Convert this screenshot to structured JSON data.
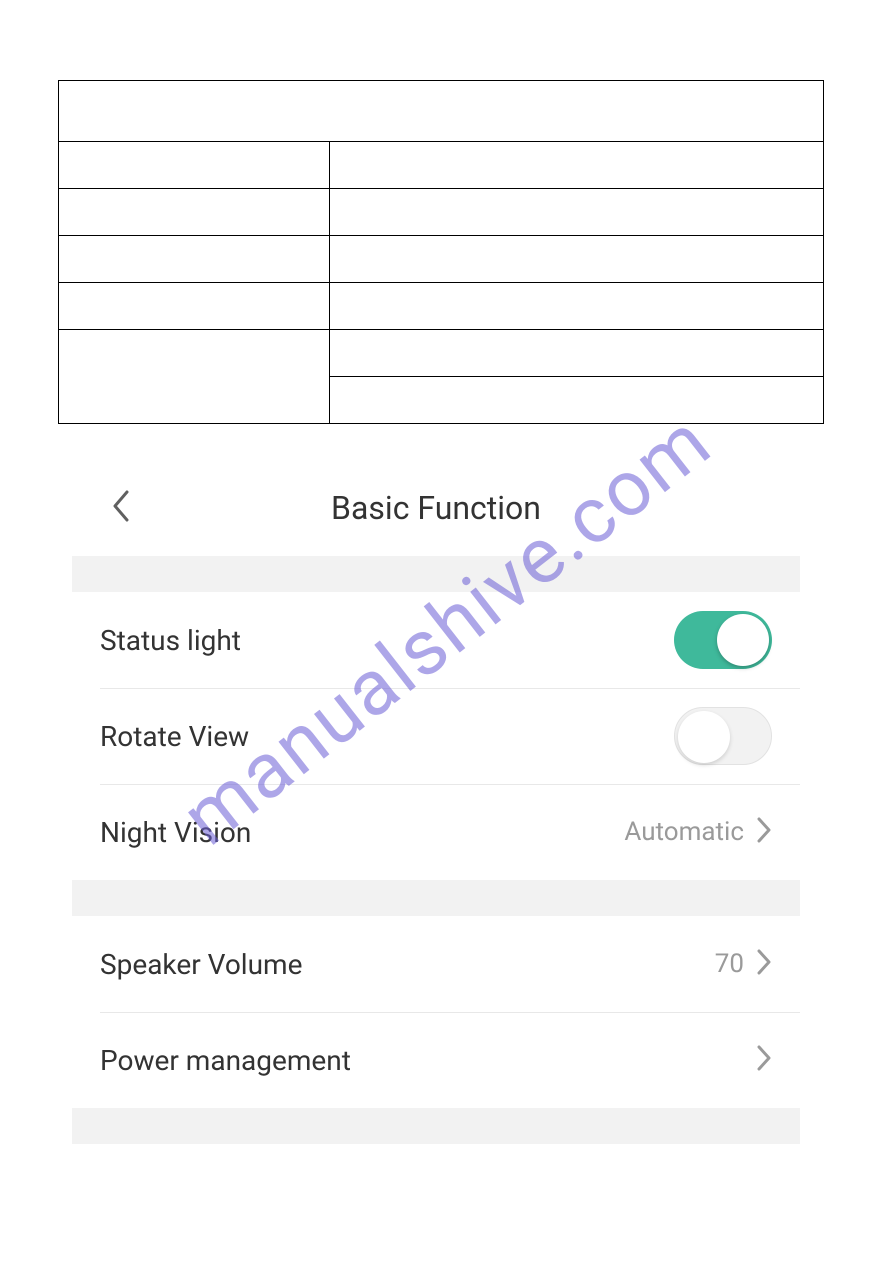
{
  "header": {
    "title": "Basic Function"
  },
  "rows": {
    "status_light": {
      "label": "Status light",
      "on": true
    },
    "rotate_view": {
      "label": "Rotate View",
      "on": false
    },
    "night_vision": {
      "label": "Night Vision",
      "value": "Automatic"
    },
    "speaker_volume": {
      "label": "Speaker Volume",
      "value": "70"
    },
    "power_management": {
      "label": "Power management"
    }
  },
  "watermark": "manualshive.com",
  "colors": {
    "toggle_on": "#3fb99b",
    "text_primary": "#333333",
    "text_secondary": "#9a9a9a",
    "divider": "#e8e8e8",
    "section_bg": "#f2f2f2"
  }
}
